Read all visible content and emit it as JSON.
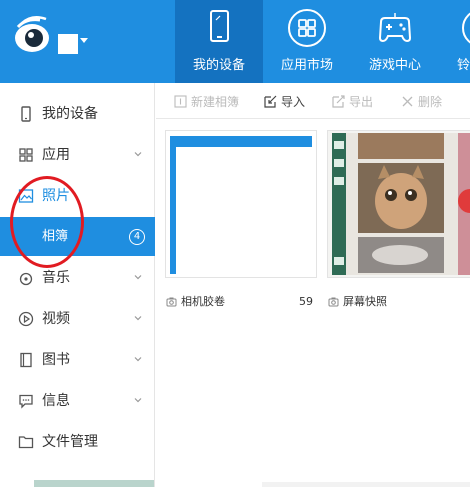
{
  "header": {
    "tabs": [
      {
        "label": "我的设备",
        "icon": "tablet-icon",
        "active": true
      },
      {
        "label": "应用市场",
        "icon": "apps-grid-icon",
        "active": false
      },
      {
        "label": "游戏中心",
        "icon": "gamepad-icon",
        "active": false
      },
      {
        "label": "铃",
        "icon": "ringtone-icon",
        "active": false
      }
    ]
  },
  "sidebar": {
    "items": [
      {
        "label": "我的设备",
        "icon": "phone-icon"
      },
      {
        "label": "应用",
        "icon": "apps-icon"
      },
      {
        "label": "照片",
        "icon": "photo-icon"
      },
      {
        "label": "相簿",
        "badge": "4"
      },
      {
        "label": "音乐",
        "icon": "music-icon"
      },
      {
        "label": "视频",
        "icon": "video-icon"
      },
      {
        "label": "图书",
        "icon": "book-icon"
      },
      {
        "label": "信息",
        "icon": "message-icon"
      },
      {
        "label": "文件管理",
        "icon": "folder-icon"
      }
    ]
  },
  "toolbar": {
    "new_album": "新建相簿",
    "import": "导入",
    "export": "导出",
    "delete": "删除"
  },
  "albums": [
    {
      "name": "相机胶卷",
      "count": "59"
    },
    {
      "name": "屏幕快照",
      "count": ""
    }
  ],
  "colors": {
    "header_bg": "#1f8ee0",
    "active_tab": "#1472c0",
    "selected_item": "#1f8ee0",
    "annotation": "#e11b22"
  }
}
